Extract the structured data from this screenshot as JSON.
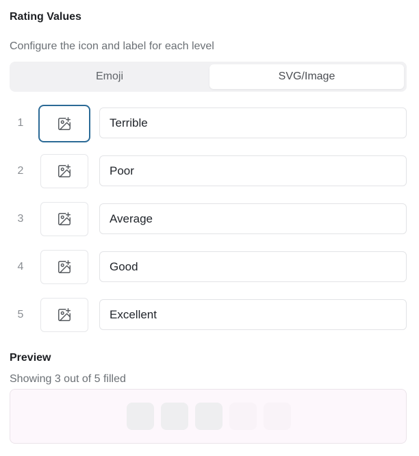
{
  "rating_values": {
    "title": "Rating Values",
    "subtitle": "Configure the icon and label for each level"
  },
  "tabs": {
    "emoji_label": "Emoji",
    "svg_label": "SVG/Image",
    "selected": "SVG/Image"
  },
  "levels": [
    {
      "number": "1",
      "label": "Terrible",
      "icon": "image-add-icon"
    },
    {
      "number": "2",
      "label": "Poor",
      "icon": "image-add-icon"
    },
    {
      "number": "3",
      "label": "Average",
      "icon": "image-add-icon"
    },
    {
      "number": "4",
      "label": "Good",
      "icon": "image-add-icon"
    },
    {
      "number": "5",
      "label": "Excellent",
      "icon": "image-add-icon"
    }
  ],
  "preview": {
    "title": "Preview",
    "status": "Showing 3 out of 5 filled",
    "filled": 3,
    "total": 5
  },
  "colors": {
    "focus_ring": "#2b6a96",
    "preview_bg": "#fdf7fc",
    "filled_slot": "#eeeef0"
  }
}
